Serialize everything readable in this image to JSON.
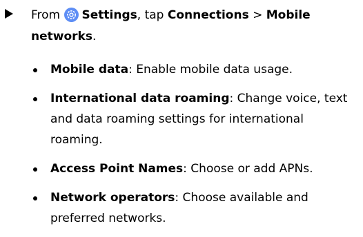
{
  "step": {
    "prefix": "From ",
    "settings_icon": "settings-gear-icon",
    "settings_label": "Settings",
    "middle": ", tap ",
    "connections_label": "Connections",
    "separator": " > ",
    "mobile_networks_label": "Mobile networks",
    "end": "."
  },
  "items": [
    {
      "title": "Mobile data",
      "description": ": Enable mobile data usage."
    },
    {
      "title": "International data roaming",
      "description": ": Change voice, text and data roaming settings for international roaming."
    },
    {
      "title": "Access Point Names",
      "description": ": Choose or add APNs."
    },
    {
      "title": "Network operators",
      "description": ": Choose available and preferred networks."
    }
  ],
  "colors": {
    "settings_icon": "#5e8ef5",
    "text": "#000000"
  }
}
